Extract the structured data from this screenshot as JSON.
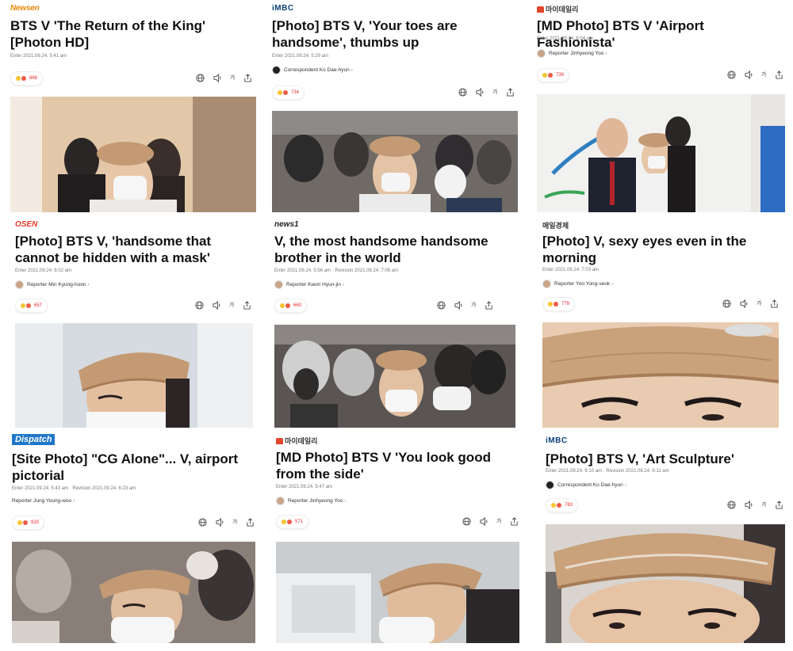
{
  "cards": [
    {
      "publisher": "Newsen",
      "title": "BTS V 'The Return of the King' [Photon HD]",
      "meta": "Enter 2021.09.24. 5:41 am",
      "reporter": "",
      "reactions": "868",
      "image": "photo-v-beret-airport"
    },
    {
      "publisher": "iMBC",
      "title": "[Photo] BTS V, 'Your toes are handsome', thumbs up",
      "meta": "Enter 2021.09.24. 5:29 am",
      "reporter": "Correspondent Ko Dae-hyun",
      "reactions": "734",
      "image": "photo-v-crowd-airport"
    },
    {
      "publisher": "마이데일리",
      "title": "[MD Photo] BTS V 'Airport Fashionista'",
      "meta": "Enter 2021.09.24. 6:04 am",
      "reporter": "Reporter Jinhyeong Yoo",
      "reactions": "739",
      "image": "photo-v-incheon"
    },
    {
      "publisher": "OSEN",
      "title": "[Photo] BTS V, 'handsome that cannot be hidden with a mask'",
      "meta": "Enter 2021.09.24. 6:02 am",
      "reporter": "Reporter Min Kyung-hoon",
      "reactions": "657",
      "image": "photo-v-beret-closeup"
    },
    {
      "publisher": "news1",
      "title": "V, the most handsome handsome brother in the world",
      "meta": "Enter 2021.09.24. 5:56 am · Revision 2021.09.24. 7:06 am",
      "reporter": "Reporter Kwon Hyun-jin",
      "reactions": "660",
      "image": "photo-v-crowd-hoodies"
    },
    {
      "publisher": "매일경제",
      "title": "[Photo] V, sexy eyes even in the morning",
      "meta": "Enter 2021.09.24. 7:03 am",
      "reporter": "Reporter Yoo Yong-seok",
      "reactions": "779",
      "image": "photo-v-eyes-closeup"
    },
    {
      "publisher": "Dispatch",
      "title": "[Site Photo] \"CG Alone\"... V, airport pictorial",
      "meta": "Enter 2021.09.24. 5:43 am · Revision 2021.09.24. 6:23 am",
      "reporter": "Reporter Jung Young-woo",
      "reactions": "920",
      "image": "photo-v-side-crowd"
    },
    {
      "publisher": "마이데일리",
      "title": "[MD Photo] BTS V 'You look good from the side'",
      "meta": "Enter 2021.09.24. 5:47 am",
      "reporter": "Reporter Jinhyeong Yoo",
      "reactions": "571",
      "image": "photo-v-side-profile"
    },
    {
      "publisher": "iMBC",
      "title": "[Photo] BTS V, 'Art Sculpture'",
      "meta": "Enter 2021.09.24. 6:10 am · Revision 2021.09.24. 6:11 am",
      "reporter": "Correspondent Ko Dae-hyun",
      "reactions": "783",
      "image": "photo-v-art-sculpture"
    }
  ],
  "tools": {
    "globe": "globe-icon",
    "audio": "speaker-icon",
    "font": "가",
    "share": "share-icon"
  },
  "colors": {
    "reaction_text": "#e4262b",
    "beret": "#c49a74"
  }
}
